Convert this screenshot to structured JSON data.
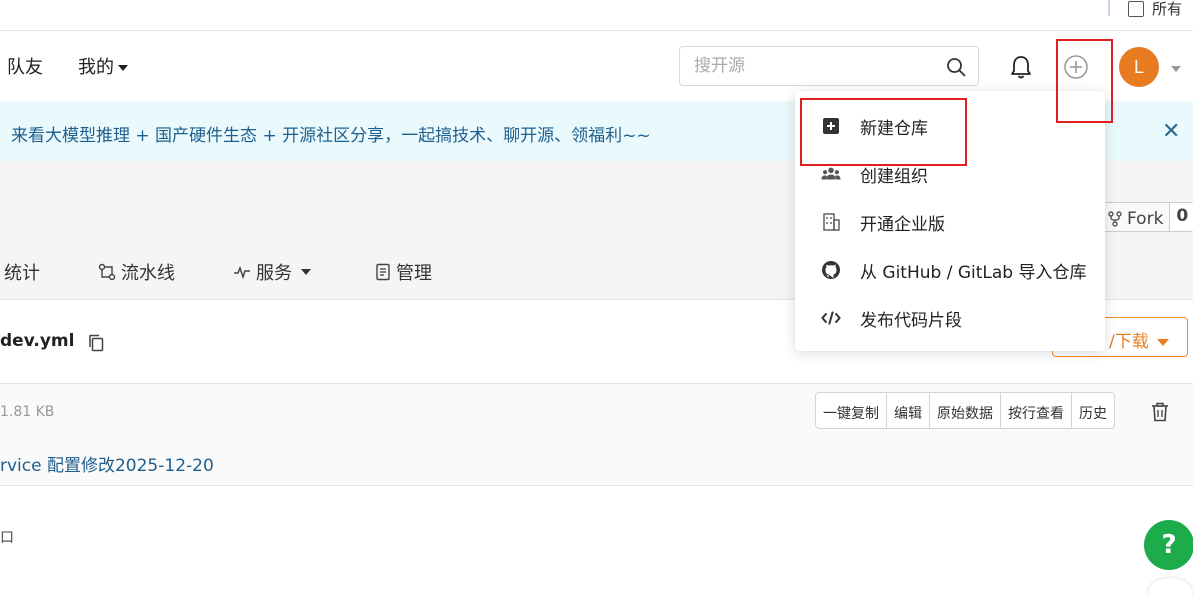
{
  "top": {
    "all_label": "所有"
  },
  "nav": {
    "teammates": "队友",
    "mine": "我的",
    "search_placeholder": "搜开源",
    "avatar_letter": "L"
  },
  "banner": {
    "text": "来看大模型推理 + 国产硬件生态 + 开源社区分享，一起搞技术、聊开源、领福利~~",
    "close": "✕"
  },
  "repo": {
    "fork_label": "Fork",
    "fork_count": "0",
    "tabs": [
      {
        "label": "统计",
        "icon": "chart-icon"
      },
      {
        "label": "流水线",
        "icon": "pipeline-icon"
      },
      {
        "label": "服务",
        "icon": "pulse-icon"
      },
      {
        "label": "管理",
        "icon": "doc-icon"
      }
    ]
  },
  "file": {
    "name": "dev.yml",
    "download_label": "/下载",
    "size": "1.81 KB",
    "actions": [
      "一键复制",
      "编辑",
      "原始数据",
      "按行查看",
      "历史"
    ],
    "commit_message": "rvice 配置修改2025-12-20",
    "content_glyph": "口"
  },
  "dropdown": {
    "items": [
      {
        "label": "新建仓库",
        "icon": "plus-square-icon"
      },
      {
        "label": "创建组织",
        "icon": "users-icon"
      },
      {
        "label": "开通企业版",
        "icon": "building-icon"
      },
      {
        "label": "从 GitHub / GitLab 导入仓库",
        "icon": "github-icon"
      },
      {
        "label": "发布代码片段",
        "icon": "code-icon"
      }
    ]
  },
  "help": {
    "label": "?"
  },
  "colors": {
    "accent_orange": "#e87a22",
    "help_green": "#1eab4b",
    "highlight_red": "#e0201e",
    "banner_bg": "#eafafc",
    "link_blue": "#1f5f8f"
  }
}
